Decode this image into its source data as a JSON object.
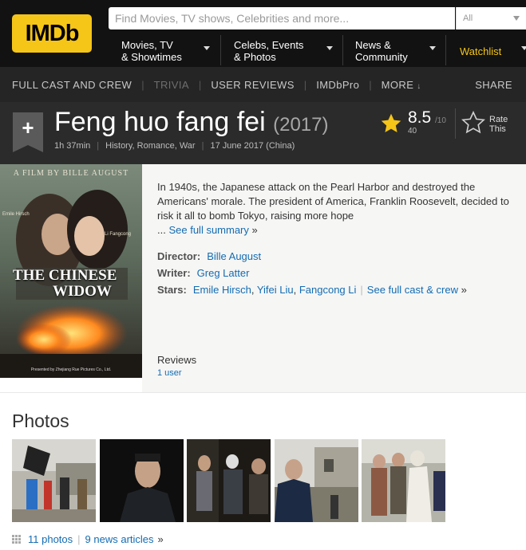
{
  "header": {
    "logo_text": "IMDb",
    "search_placeholder": "Find Movies, TV shows, Celebrities and more...",
    "search_category": "All",
    "nav": [
      {
        "line1": "Movies, TV",
        "line2": "& Showtimes"
      },
      {
        "line1": "Celebs, Events",
        "line2": "& Photos"
      },
      {
        "line1": "News &",
        "line2": "Community"
      }
    ],
    "watchlist": "Watchlist",
    "brand_color": "#f5c518"
  },
  "subnav": {
    "full_cast": "FULL CAST AND CREW",
    "trivia": "TRIVIA",
    "user_reviews": "USER REVIEWS",
    "imdbpro": "IMDbPro",
    "more": "MORE",
    "share": "SHARE"
  },
  "title": {
    "name": "Feng huo fang fei",
    "year": "(2017)",
    "runtime": "1h 37min",
    "genres": "History, Romance, War",
    "release": "17 June 2017 (China)",
    "rating": "8.5",
    "rating_max": "/10",
    "rating_count": "40",
    "rate_label_1": "Rate",
    "rate_label_2": "This"
  },
  "poster": {
    "top_text": "A FILM BY BILLE AUGUST",
    "title_line1": "THE CHINESE",
    "title_line2": "WIDOW",
    "left_name": "Emile Hirsch",
    "right_name": "Li Fangcong",
    "presented": "Presented by Zhejiang Rue Pictures Co., Ltd."
  },
  "main": {
    "summary": "In 1940s, the Japanese attack on the Pearl Harbor and destroyed the Americans' morale. The president of America, Franklin Roosevelt, decided to risk it all to bomb Tokyo, raising more hope",
    "ellipsis": "...",
    "see_summary": "See full summary",
    "director_label": "Director:",
    "director": "Bille August",
    "writer_label": "Writer:",
    "writer": "Greg Latter",
    "stars_label": "Stars:",
    "stars": [
      "Emile Hirsch",
      "Yifei Liu",
      "Fangcong Li"
    ],
    "see_cast": "See full cast & crew",
    "reviews_label": "Reviews",
    "reviews_count": "1 user"
  },
  "photos": {
    "title": "Photos",
    "count_link": "11 photos",
    "news_link": "9 news articles",
    "thumbs": [
      "photo-1",
      "photo-2",
      "photo-3",
      "photo-4",
      "photo-5"
    ]
  }
}
